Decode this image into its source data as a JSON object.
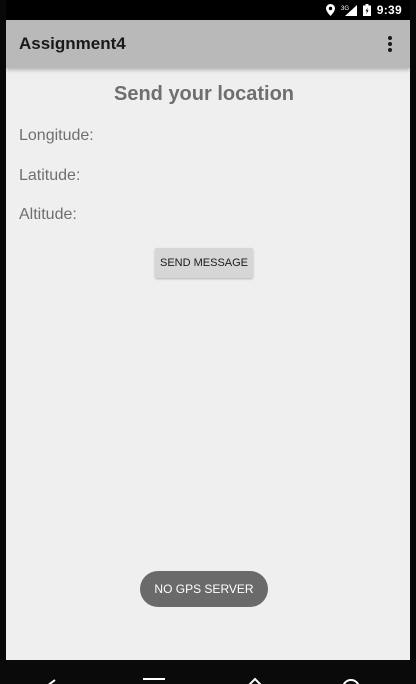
{
  "status_bar": {
    "time": "9:39",
    "network_label": "3G",
    "icons": [
      "location-pin-icon",
      "signal-3g-icon",
      "battery-icon"
    ]
  },
  "app_bar": {
    "title": "Assignment4",
    "overflow_icon": "more-vert-icon"
  },
  "main": {
    "heading": "Send your location",
    "fields": [
      {
        "label": "Longitude:"
      },
      {
        "label": "Latitude:"
      },
      {
        "label": "Altitude:"
      }
    ],
    "send_button_label": "SEND MESSAGE"
  },
  "toast": {
    "text": "NO GPS SERVER"
  },
  "nav_bar": {
    "icons": [
      "back-icon",
      "menu-icon",
      "home-icon",
      "search-icon"
    ]
  },
  "colors": {
    "app_bar_bg": "#b9b9b9",
    "screen_bg": "#efefef",
    "label_text": "#6f6f6f",
    "button_bg": "#d6d6d6",
    "toast_bg": "#6a6a6a"
  }
}
